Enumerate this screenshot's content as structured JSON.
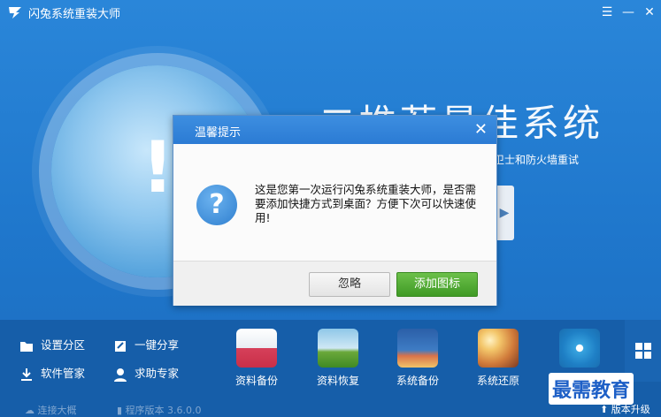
{
  "window": {
    "title": "闪兔系统重装大师"
  },
  "hero": {
    "slogan": "二推荐最佳系统",
    "subtext": "卫士和防火墙重试"
  },
  "dialog": {
    "title": "温馨提示",
    "message": "这是您第一次运行闪兔系统重装大师，是否需要添加快捷方式到桌面？方便下次可以快速使用!",
    "ignore_label": "忽略",
    "add_label": "添加图标"
  },
  "tools": [
    {
      "label": "设置分区",
      "icon": "folder-icon"
    },
    {
      "label": "一键分享",
      "icon": "share-icon"
    },
    {
      "label": "软件管家",
      "icon": "download-icon"
    },
    {
      "label": "求助专家",
      "icon": "person-icon"
    }
  ],
  "features": [
    {
      "label": "资料备份"
    },
    {
      "label": "资料恢复"
    },
    {
      "label": "系统备份"
    },
    {
      "label": "系统还原"
    }
  ],
  "status": {
    "left": "连接大概",
    "version": "程序版本 3.6.0.0",
    "upgrade": "版本升级"
  },
  "watermark": "最需教育"
}
